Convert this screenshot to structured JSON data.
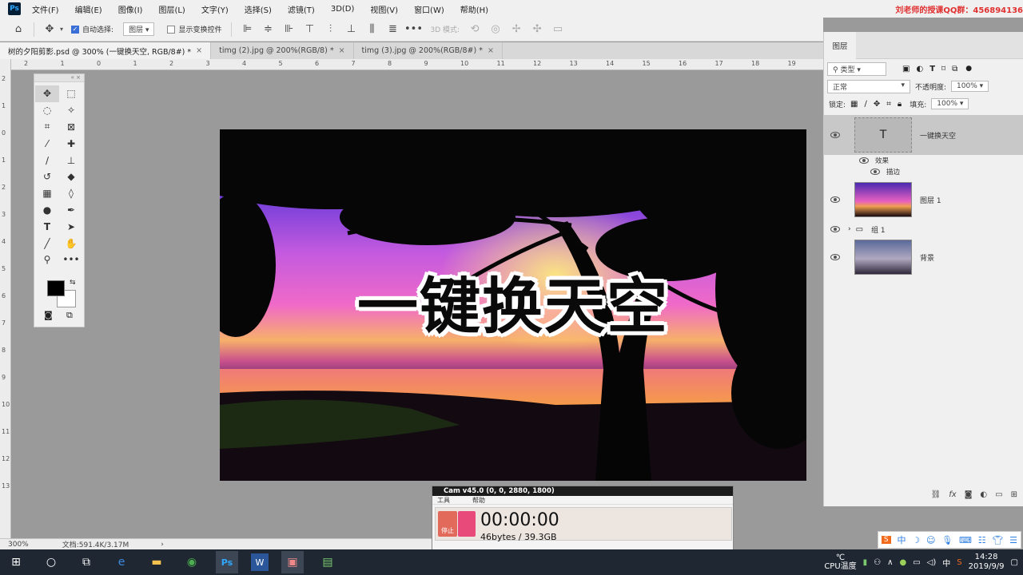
{
  "menubar": {
    "logo": "Ps",
    "items": [
      "文件(F)",
      "编辑(E)",
      "图像(I)",
      "图层(L)",
      "文字(Y)",
      "选择(S)",
      "滤镜(T)",
      "3D(D)",
      "视图(V)",
      "窗口(W)",
      "帮助(H)"
    ],
    "promo": "刘老师的授课QQ群：456894136"
  },
  "optbar": {
    "auto_select_label": "自动选择:",
    "auto_select_value": "图层",
    "show_transform_label": "显示变换控件",
    "mode_3d_label": "3D 模式:"
  },
  "tabs": [
    {
      "label": "树的夕阳剪影.psd @ 300% (一键换天空, RGB/8#) *",
      "close": "×"
    },
    {
      "label": "timg (2).jpg @ 200%(RGB/8) *",
      "close": "×"
    },
    {
      "label": "timg (3).jpg @ 200%(RGB/8#) *",
      "close": "×"
    }
  ],
  "ruler_h": [
    "2",
    "1",
    "0",
    "1",
    "2",
    "3",
    "4",
    "5",
    "6",
    "7",
    "8",
    "9",
    "10",
    "11",
    "12",
    "13",
    "14",
    "15",
    "16",
    "17",
    "18",
    "19"
  ],
  "ruler_v": [
    "2",
    "1",
    "0",
    "1",
    "2",
    "3",
    "4",
    "5",
    "6",
    "7",
    "8",
    "9",
    "10",
    "11",
    "12",
    "13"
  ],
  "canvas": {
    "title": "一键换天空"
  },
  "statusbar": {
    "zoom": "300%",
    "doc_size": "文档:591.4K/3.17M",
    "arrow": "›"
  },
  "layers_panel": {
    "tab_label": "图层",
    "filter_type": "类型",
    "blend_mode": "正常",
    "opacity_label": "不透明度:",
    "opacity_value": "100%",
    "lock_label": "锁定:",
    "fill_label": "填充:",
    "fill_value": "100%",
    "layers": [
      {
        "name": "一键换天空",
        "type": "text"
      },
      {
        "name": "效果",
        "type": "effect"
      },
      {
        "name": "描边",
        "type": "effect-item"
      },
      {
        "name": "图层 1",
        "type": "image"
      },
      {
        "name": "组 1",
        "type": "group"
      },
      {
        "name": "背景",
        "type": "image"
      }
    ],
    "footer_icons": [
      "link-icon",
      "fx-icon",
      "mask-icon",
      "adjustment-icon",
      "folder-icon",
      "new-layer-icon"
    ],
    "fx_label": "fx"
  },
  "cam": {
    "title": "Cam v45.0 (0, 0, 2880, 1800)",
    "menu": [
      "工具",
      "帮助"
    ],
    "stop_label": "停止",
    "timer": "00:00:00",
    "size": "46bytes / 39.3GB"
  },
  "ime": {
    "label": "中"
  },
  "taskbar": {
    "ps_label": "Ps",
    "word_label": "W",
    "temp": "℃",
    "cpu_label": "CPU温度",
    "ime_label": "中",
    "time": "14:28",
    "date": "2019/9/9"
  }
}
